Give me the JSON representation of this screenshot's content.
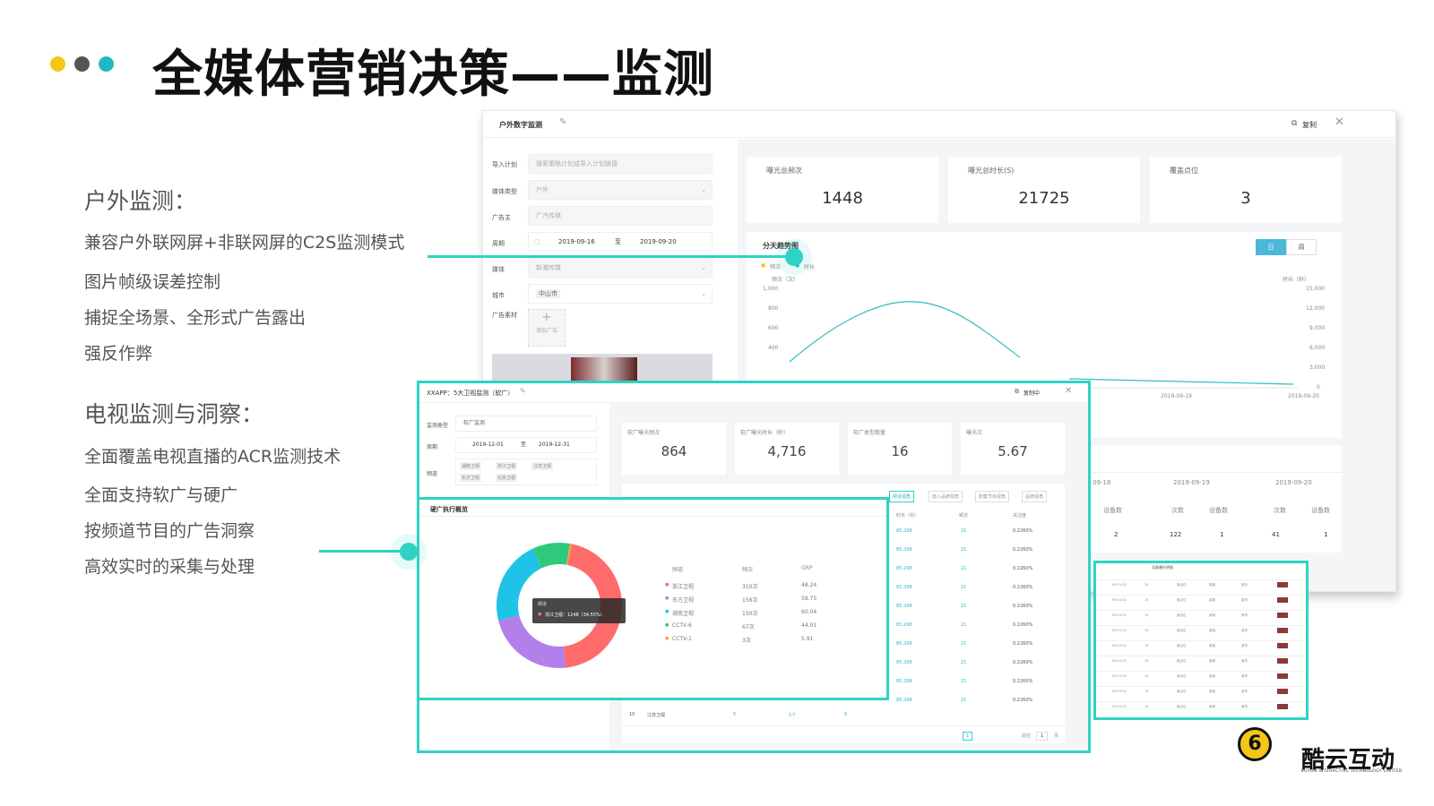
{
  "title": "全媒体营销决策——监测",
  "dots": [
    "#f5c518",
    "#555555",
    "#1fb8c6"
  ],
  "accent": "#2fd3c4",
  "left": {
    "outdoor_title": "户外监测：",
    "outdoor_points": [
      "兼容户外联网屏+非联网屏的C2S监测模式",
      "图片帧级误差控制",
      "捕捉全场景、全形式广告露出",
      "强反作弊"
    ],
    "tv_title": "电视监测与洞察：",
    "tv_points": [
      "全面覆盖电视直播的ACR监测技术",
      "全面支持软广与硬广",
      "按频道节目的广告洞察",
      "高效实时的采集与处理"
    ]
  },
  "outdoor": {
    "window_title": "户外数字监测",
    "copy_label": "复制",
    "form": {
      "import_label": "导入计划",
      "import_placeholder": "搜索策略计划或导入计划链接",
      "media_type_label": "媒体类型",
      "media_type_value": "户外",
      "advertiser_label": "广告主",
      "advertiser_value": "广汽传祺",
      "period_label": "周期",
      "period_start": "2019-09-16",
      "period_to": "至",
      "period_end": "2019-09-20",
      "media_label": "媒体",
      "media_value": "新潮传媒",
      "city_label": "城市",
      "city_value": "中山市",
      "material_label": "广告素材",
      "material_add": "添加广告"
    },
    "stats": [
      {
        "label": "曝光总频次",
        "value": "1448"
      },
      {
        "label": "曝光总时长(S)",
        "value": "21725"
      },
      {
        "label": "覆盖点位",
        "value": "3"
      }
    ],
    "trend": {
      "title": "分天趋势图",
      "toggle_day": "日",
      "toggle_week": "周",
      "legend": [
        "频次",
        "时长"
      ],
      "left_axis_label": "频次（次）",
      "right_axis_label": "时长（秒）",
      "left_ticks": [
        "1,000",
        "800",
        "600",
        "400"
      ],
      "right_ticks": [
        "15,000",
        "12,000",
        "9,000",
        "6,000",
        "3,000",
        "0"
      ],
      "x_ticks": [
        "2019-09-19",
        "2019-09-20"
      ]
    },
    "daily_table": {
      "dates": [
        "09-18",
        "2019-09-19",
        "2019-09-20"
      ],
      "cols": [
        "设备数",
        "次数",
        "设备数",
        "次数",
        "设备数"
      ],
      "row": [
        "2",
        "122",
        "1",
        "41",
        "1"
      ],
      "goto": "前往",
      "page": "1",
      "page_suffix": "页"
    }
  },
  "tv": {
    "window_title": "XXAPP：5大卫视监测（软广）",
    "copy_label": "复制中",
    "form": {
      "type_label": "监测类型",
      "type_value": "软广监测",
      "period_label": "周期",
      "period_start": "2019-12-01",
      "period_to": "至",
      "period_end": "2019-12-31",
      "channel_label": "频道",
      "channels": [
        "湖南卫视",
        "浙江卫视",
        "江苏卫视",
        "东方卫视",
        "北京卫视"
      ]
    },
    "stats": [
      {
        "label": "软广曝光频次",
        "value": "864"
      },
      {
        "label": "软广曝光时长（秒）",
        "value": "4,716"
      },
      {
        "label": "软广类型数量",
        "value": "16"
      },
      {
        "label": "曝光次",
        "value": "5.67"
      }
    ],
    "view_tabs": [
      "频道视角",
      "植入品牌视角",
      "剧集节目视角",
      "品牌视角"
    ],
    "table_head": [
      "时长（秒）",
      "频次",
      "关注度"
    ],
    "table_row": [
      "85.298",
      "21",
      "0.2260%"
    ],
    "last_row": [
      "10",
      "江苏卫视",
      "5",
      "1个",
      "6",
      "85.298",
      "21",
      "0.2260%"
    ],
    "pagination": {
      "page": "1",
      "goto": "前往",
      "page_num": "1",
      "suffix": "页"
    }
  },
  "hard": {
    "title": "硬广执行概览",
    "headers": [
      "频道",
      "频次",
      "GRP"
    ],
    "rows": [
      {
        "name": "浙江卫视",
        "freq": "310次",
        "grp": "48.24",
        "color": "#ff6b6b"
      },
      {
        "name": "东方卫视",
        "freq": "156次",
        "grp": "58.75",
        "color": "#b37feb"
      },
      {
        "name": "湖南卫视",
        "freq": "150次",
        "grp": "60.04",
        "color": "#1fc3e8"
      },
      {
        "name": "CCTV-6",
        "freq": "67次",
        "grp": "44.01",
        "color": "#2ec97b"
      },
      {
        "name": "CCTV-1",
        "freq": "3次",
        "grp": "5.91",
        "color": "#f7a531"
      }
    ],
    "tooltip_title": "频道",
    "tooltip_text": "浙江卫视：1248（34.55%）"
  },
  "detail": {
    "title": "设备曝光明细",
    "row_text": [
      "09:15:32",
      "15",
      "某点位",
      "某城",
      "某市"
    ]
  },
  "logo": {
    "name": "酷云互动",
    "sub": "KUYUN INTERACTIVE TECHNOLOGY LIMITED",
    "mark": "6"
  },
  "chart_data": {
    "type": "pie",
    "title": "硬广执行概览",
    "categories": [
      "浙江卫视",
      "东方卫视",
      "湖南卫视",
      "CCTV-6",
      "CCTV-1"
    ],
    "values": [
      310,
      156,
      150,
      67,
      3
    ],
    "colors": [
      "#ff6b6b",
      "#b37feb",
      "#1fc3e8",
      "#2ec97b",
      "#f7a531"
    ],
    "donut": true
  }
}
